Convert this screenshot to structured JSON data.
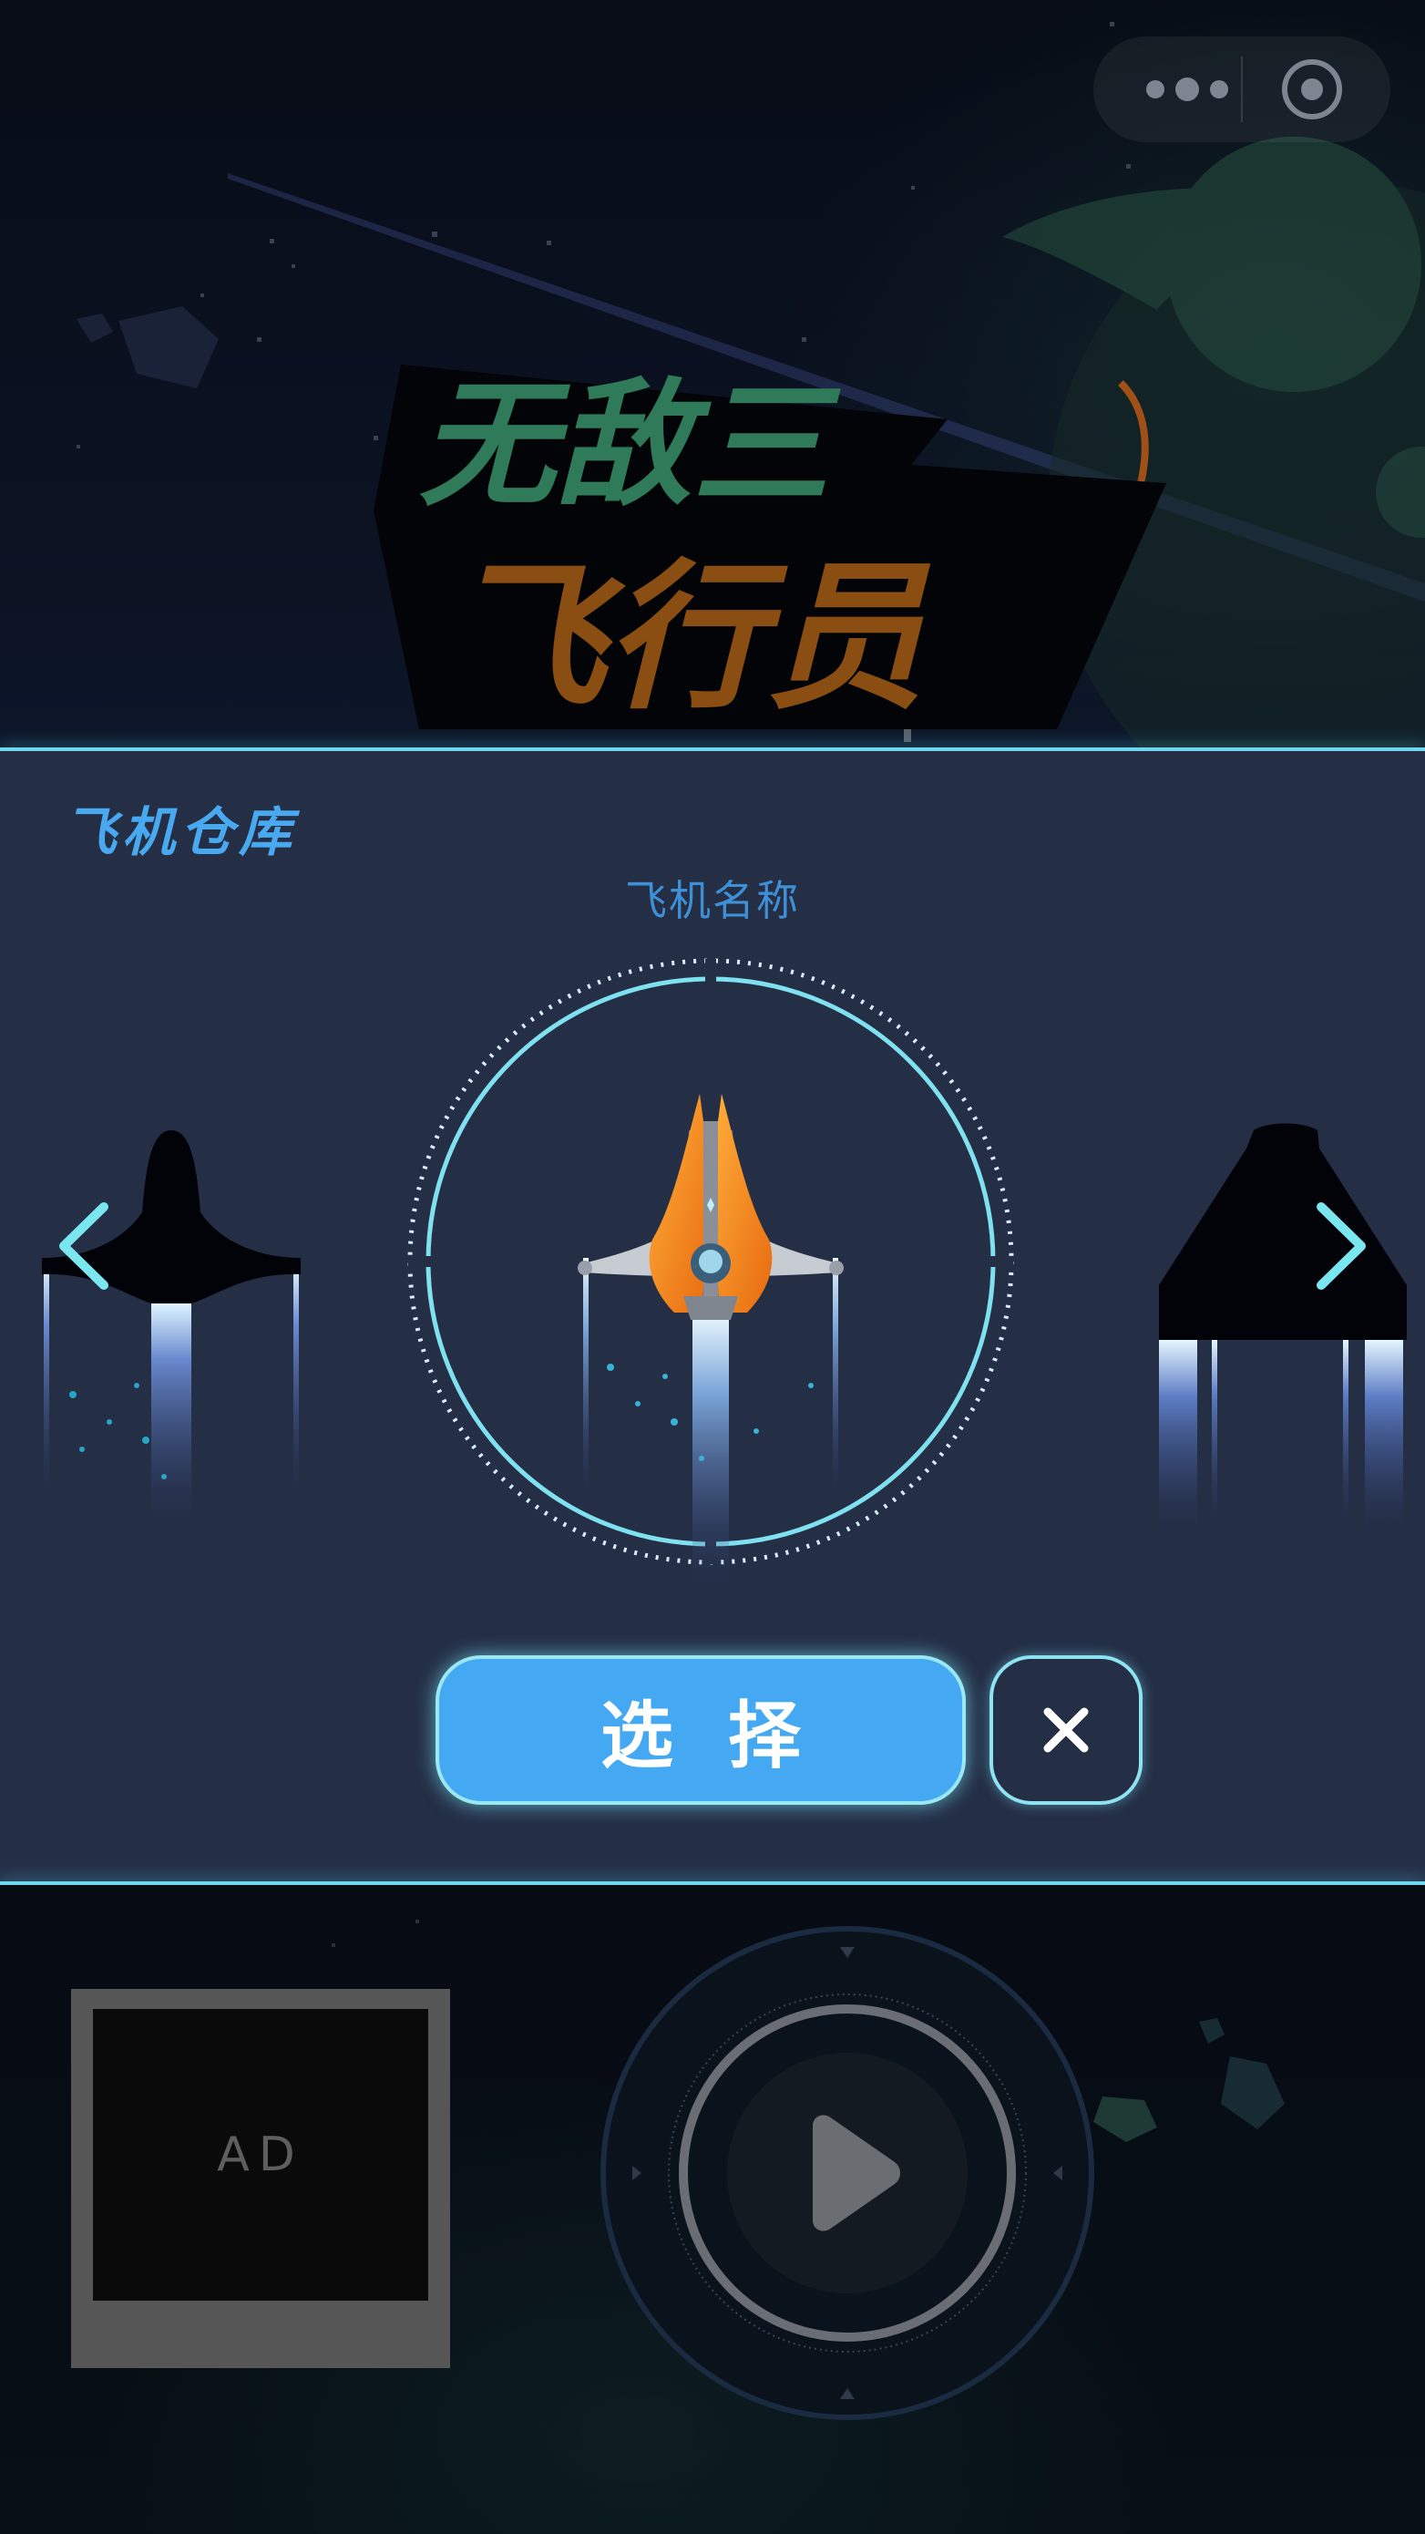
{
  "header": {
    "title_line1": "无敌三",
    "title_line2": "飞行员"
  },
  "menu_capsule": {
    "more_icon": "more-dots-icon",
    "close_icon": "target-icon"
  },
  "hangar": {
    "title": "飞机仓库",
    "plane_name": "飞机名称",
    "select_label": "选择",
    "close_label": "×"
  },
  "ad": {
    "label": "AD"
  },
  "controls": {
    "play_icon": "play-icon"
  },
  "colors": {
    "accent": "#44a8f2",
    "glow": "#6fd8ee",
    "panel": "#242e45",
    "title_green": "#2f7a58",
    "title_orange": "#c76a1a"
  }
}
